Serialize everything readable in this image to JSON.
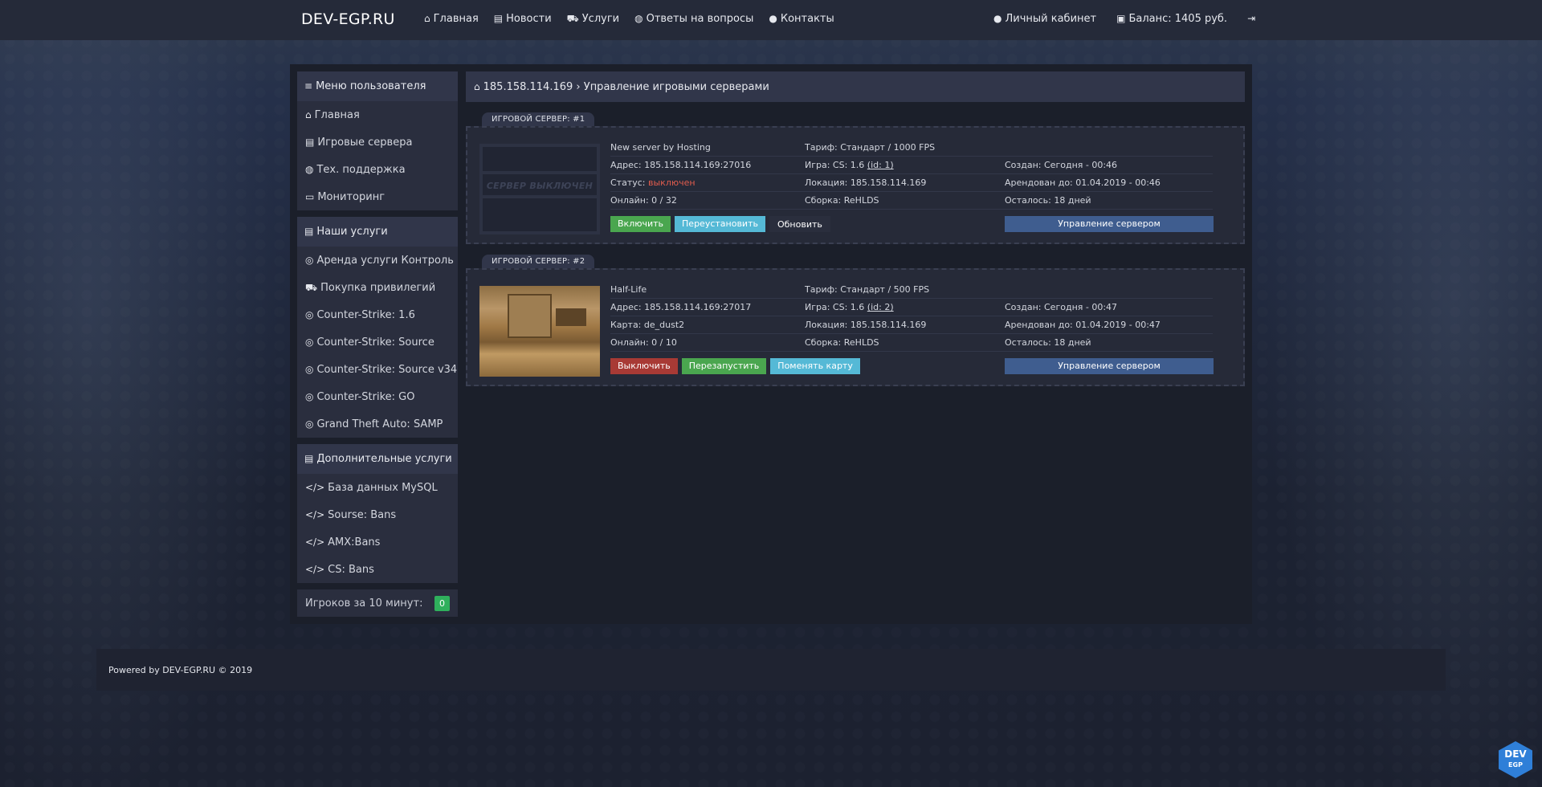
{
  "topbar": {
    "brand": "DEV-EGP.RU",
    "nav": [
      "Главная",
      "Новости",
      "Услуги",
      "Ответы на вопросы",
      "Контакты"
    ],
    "account": "Личный кабинет",
    "balance": "Баланс: 1405 руб.",
    "icons": [
      "home-icon",
      "news-icon",
      "cart-icon",
      "globe-icon",
      "user-icon",
      "user-icon",
      "money-icon",
      "logout-icon"
    ]
  },
  "sidebar": {
    "user_menu": {
      "title": "Меню пользователя",
      "items": [
        "Главная",
        "Игровые сервера",
        "Тех. поддержка",
        "Мониторинг"
      ]
    },
    "services": {
      "title": "Наши услуги",
      "items": [
        "Аренда услуги Контроль",
        "Покупка привилегий",
        "Counter-Strike: 1.6",
        "Counter-Strike: Source",
        "Counter-Strike: Source v34",
        "Counter-Strike: GO",
        "Grand Theft Auto: SAMP"
      ]
    },
    "extra": {
      "title": "Дополнительные услуги",
      "items": [
        "База данных MySQL",
        "Sourse: Bans",
        "AMX:Bans",
        "CS: Bans"
      ]
    },
    "players": {
      "label": "Игроков за 10 минут:",
      "value": "0"
    }
  },
  "breadcrumb": {
    "ip": "185.158.114.169",
    "separator": "›",
    "page": "Управление игровыми серверами"
  },
  "servers": [
    {
      "tab": "ИГРОВОЙ СЕРВЕР: #1",
      "thumb_text": "СЕРВЕР ВЫКЛЮЧЕН",
      "name": "New server by Hosting",
      "tariff": "Тариф: Стандарт / 1000 FPS",
      "address": "Адрес: 185.158.114.169:27016",
      "game_label": "Игра: CS: 1.6",
      "game_id": "(id: 1)",
      "created": "Создан: Сегодня - 00:46",
      "status_label": "Статус:",
      "status_value": "выключен",
      "location": "Локация: 185.158.114.169",
      "rented": "Арендован до: 01.04.2019 - 00:46",
      "online": "Онлайн: 0 / 32",
      "build": "Сборка: ReHLDS",
      "remaining": "Осталось: 18 дней",
      "buttons": [
        "Включить",
        "Переустановить",
        "Обновить"
      ],
      "manage": "Управление сервером"
    },
    {
      "tab": "ИГРОВОЙ СЕРВЕР: #2",
      "name": "Half-Life",
      "tariff": "Тариф: Стандарт / 500 FPS",
      "address": "Адрес: 185.158.114.169:27017",
      "game_label": "Игра: CS: 1.6",
      "game_id": "(id: 2)",
      "created": "Создан: Сегодня - 00:47",
      "map": "Карта: de_dust2",
      "location": "Локация: 185.158.114.169",
      "rented": "Арендован до: 01.04.2019 - 00:47",
      "online": "Онлайн: 0 / 10",
      "build": "Сборка: ReHLDS",
      "remaining": "Осталось: 18 дней",
      "buttons": [
        "Выключить",
        "Перезапустить",
        "Поменять карту"
      ],
      "manage": "Управление сервером"
    }
  ],
  "footer": {
    "text": "Powered by DEV-EGP.RU © 2019"
  },
  "logo": {
    "line1": "DEV",
    "line2": "EGP"
  },
  "colors": {
    "accent": "#3f5d8f",
    "green": "#4aa64f",
    "blue": "#55b9d6",
    "red": "#a83a35",
    "status_off": "#e05c4d"
  }
}
